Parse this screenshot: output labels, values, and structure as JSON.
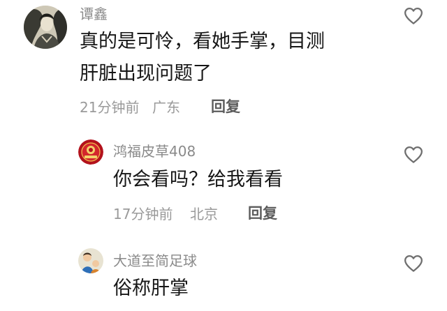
{
  "comments": [
    {
      "username": "谭鑫",
      "lines": [
        "真的是可怜，看她手掌，目测",
        "肝脏出现问题了"
      ],
      "time": "21分钟前",
      "location": "广东",
      "reply_label": "回复",
      "avatar_icon": "ink-portrait-avatar",
      "like_icon": "heart-outline-icon"
    },
    {
      "username": "鸿福皮草408",
      "lines": [
        "你会看吗？给我看看"
      ],
      "time": "17分钟前",
      "location": "北京",
      "reply_label": "回复",
      "avatar_icon": "red-emblem-avatar",
      "like_icon": "heart-outline-icon"
    },
    {
      "username": "大道至简足球",
      "lines": [
        "俗称肝掌"
      ],
      "avatar_icon": "cartoon-figure-avatar",
      "like_icon": "heart-outline-icon"
    }
  ],
  "colors": {
    "username": "#8a8a8a",
    "text": "#161616",
    "meta": "#9a9a9a",
    "reply": "#5c5c5c",
    "heart": "#6f6f6f"
  }
}
